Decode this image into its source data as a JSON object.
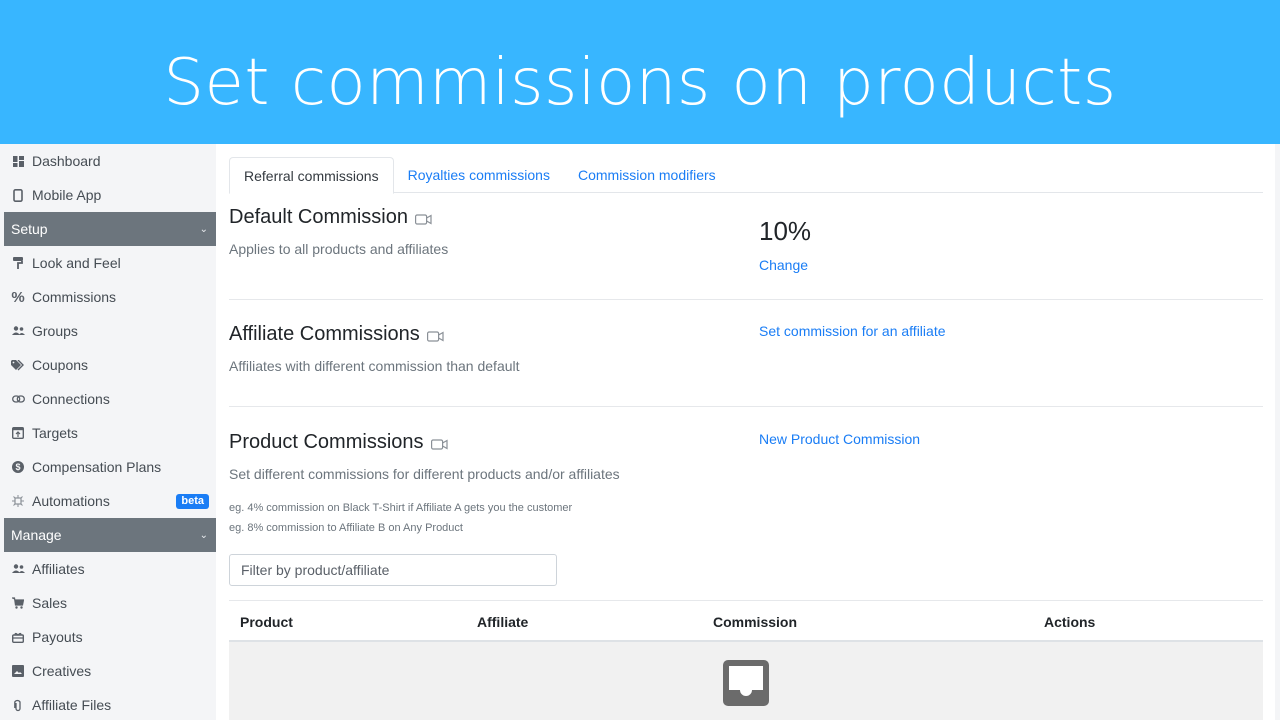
{
  "banner": {
    "title": "Set commissions on products",
    "bg_color": "#38b6ff"
  },
  "sidebar": {
    "items_top": [
      {
        "label": "Dashboard",
        "icon": "dashboard-icon"
      },
      {
        "label": "Mobile App",
        "icon": "mobile-icon"
      }
    ],
    "setup": {
      "label": "Setup",
      "items": [
        {
          "label": "Look and Feel",
          "icon": "paint-roller-icon"
        },
        {
          "label": "Commissions",
          "icon": "percent-icon"
        },
        {
          "label": "Groups",
          "icon": "users-icon"
        },
        {
          "label": "Coupons",
          "icon": "tags-icon"
        },
        {
          "label": "Connections",
          "icon": "link-icon"
        },
        {
          "label": "Targets",
          "icon": "target-box-icon"
        },
        {
          "label": "Compensation Plans",
          "icon": "dollar-circle-icon"
        },
        {
          "label": "Automations",
          "icon": "robot-icon",
          "badge": "beta"
        }
      ]
    },
    "manage": {
      "label": "Manage",
      "items": [
        {
          "label": "Affiliates",
          "icon": "users-icon"
        },
        {
          "label": "Sales",
          "icon": "cart-icon"
        },
        {
          "label": "Payouts",
          "icon": "gift-icon"
        },
        {
          "label": "Creatives",
          "icon": "image-icon"
        },
        {
          "label": "Affiliate Files",
          "icon": "paperclip-icon"
        }
      ]
    }
  },
  "tabs": [
    {
      "label": "Referral commissions",
      "active": true
    },
    {
      "label": "Royalties commissions",
      "active": false
    },
    {
      "label": "Commission modifiers",
      "active": false
    }
  ],
  "default_commission": {
    "title": "Default Commission",
    "subtitle": "Applies to all products and affiliates",
    "value": "10%",
    "action": "Change"
  },
  "affiliate_commissions": {
    "title": "Affiliate Commissions",
    "subtitle": "Affiliates with different commission than default",
    "action": "Set commission for an affiliate"
  },
  "product_commissions": {
    "title": "Product Commissions",
    "subtitle": "Set different commissions for different products and/or affiliates",
    "examples": [
      "eg. 4% commission on Black T-Shirt if Affiliate A gets you the customer",
      "eg. 8% commission to Affiliate B on Any Product"
    ],
    "action": "New Product Commission",
    "filter": {
      "placeholder": "Filter by product/affiliate",
      "value": ""
    },
    "table": {
      "columns": [
        "Product",
        "Affiliate",
        "Commission",
        "Actions"
      ],
      "rows": [],
      "empty_icon": "inbox-icon"
    }
  },
  "colors": {
    "link": "#1a7df5",
    "section_header": "#6c757d",
    "badge": "#1a7df5"
  }
}
